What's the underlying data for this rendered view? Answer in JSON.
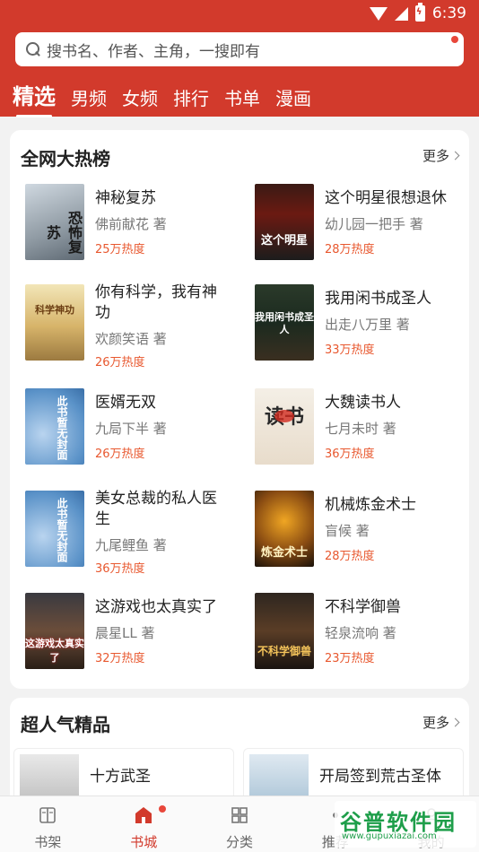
{
  "status_bar": {
    "time": "6:39",
    "battery_glyph": "ϟ"
  },
  "search": {
    "placeholder": "搜书名、作者、主角，一搜即有"
  },
  "tabs": [
    {
      "label": "精选",
      "active": true
    },
    {
      "label": "男频"
    },
    {
      "label": "女频"
    },
    {
      "label": "排行"
    },
    {
      "label": "书单"
    },
    {
      "label": "漫画"
    }
  ],
  "hot_section": {
    "title": "全网大热榜",
    "more": "更多",
    "books": [
      {
        "title": "神秘复苏",
        "author": "佛前献花 著",
        "heat": "25万热度",
        "cover_text": "恐怖复苏"
      },
      {
        "title": "这个明星很想退休",
        "author": "幼儿园一把手 著",
        "heat": "28万热度",
        "cover_text": "这个明星"
      },
      {
        "title": "你有科学，我有神功",
        "author": "欢颜笑语 著",
        "heat": "26万热度",
        "cover_text": "科学神功"
      },
      {
        "title": "我用闲书成圣人",
        "author": "出走八万里 著",
        "heat": "33万热度",
        "cover_text": "我用闲书成圣人"
      },
      {
        "title": "医婿无双",
        "author": "九局下半 著",
        "heat": "26万热度",
        "cover_text": "此书暂无封面"
      },
      {
        "title": "大魏读书人",
        "author": "七月未时 著",
        "heat": "36万热度",
        "cover_text": "读书"
      },
      {
        "title": "美女总裁的私人医生",
        "author": "九尾鲤鱼 著",
        "heat": "36万热度",
        "cover_text": "此书暂无封面"
      },
      {
        "title": "机械炼金术士",
        "author": "盲候 著",
        "heat": "28万热度",
        "cover_text": "炼金术士"
      },
      {
        "title": "这游戏也太真实了",
        "author": "晨星LL 著",
        "heat": "32万热度",
        "cover_text": "这游戏太真实了"
      },
      {
        "title": "不科学御兽",
        "author": "轻泉流响 著",
        "heat": "23万热度",
        "cover_text": "不科学御兽"
      }
    ]
  },
  "popular_section": {
    "title": "超人气精品",
    "more": "更多",
    "items": [
      {
        "title": "十方武圣"
      },
      {
        "title": "开局签到荒古圣体"
      }
    ]
  },
  "bottom_nav": [
    {
      "label": "书架"
    },
    {
      "label": "书城",
      "active": true
    },
    {
      "label": "分类"
    },
    {
      "label": "推荐"
    },
    {
      "label": "我的"
    }
  ],
  "watermark": {
    "big": "谷普软件园",
    "small": "www.gupuxiazai.com"
  },
  "colors": {
    "brand": "#d23a2c",
    "heat": "#e8582f"
  }
}
